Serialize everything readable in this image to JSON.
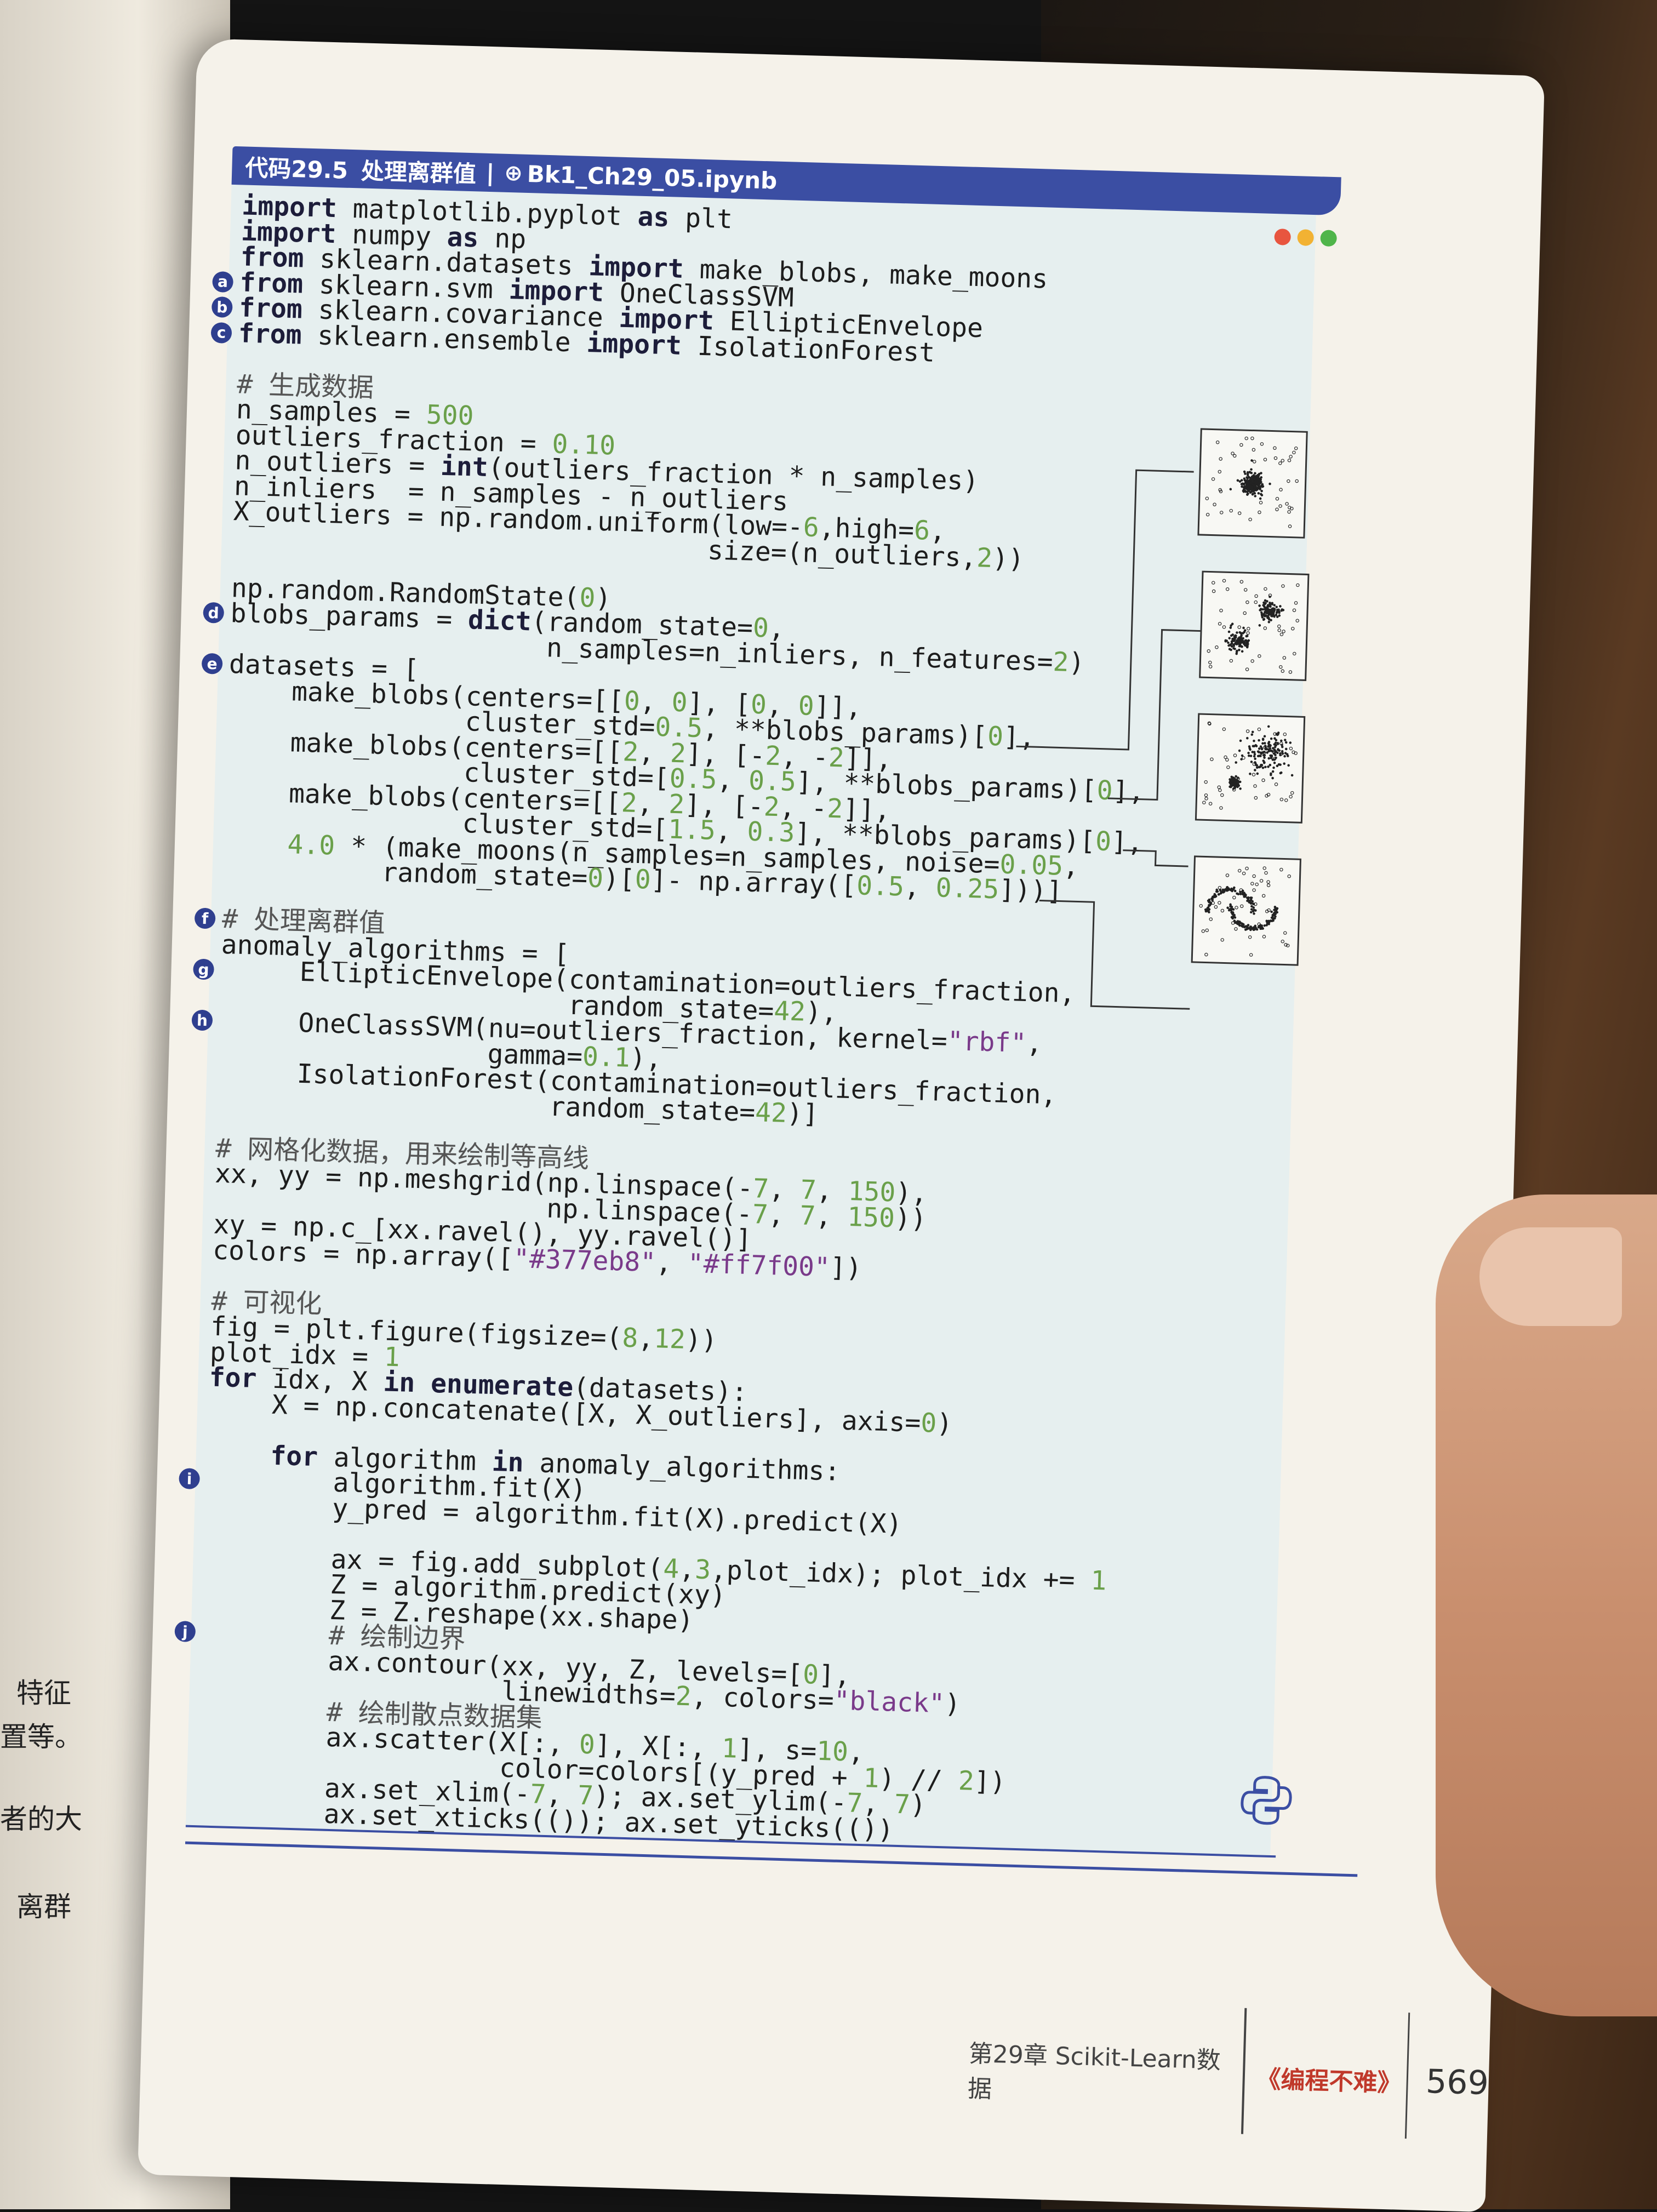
{
  "header": {
    "code_id": "代码29.5",
    "title": "处理离群值",
    "separator": "|",
    "file_icon": "notebook-icon",
    "filename": "Bk1_Ch29_05.ipynb"
  },
  "window_dots": [
    "#e8553f",
    "#f2b233",
    "#4fb54a"
  ],
  "markers": [
    {
      "letter": "a",
      "line": 3
    },
    {
      "letter": "b",
      "line": 4
    },
    {
      "letter": "c",
      "line": 5
    },
    {
      "letter": "d",
      "line": 16
    },
    {
      "letter": "e",
      "line": 18
    },
    {
      "letter": "f",
      "line": 28
    },
    {
      "letter": "g",
      "line": 30
    },
    {
      "letter": "h",
      "line": 32
    },
    {
      "letter": "i",
      "line": 50
    },
    {
      "letter": "j",
      "line": 56
    }
  ],
  "code_lines": [
    "import matplotlib.pyplot as plt",
    "import numpy as np",
    "from sklearn.datasets import make_blobs, make_moons",
    "from sklearn.svm import OneClassSVM",
    "from sklearn.covariance import EllipticEnvelope",
    "from sklearn.ensemble import IsolationForest",
    "",
    "# 生成数据",
    "n_samples = 500",
    "outliers_fraction = 0.10",
    "n_outliers = int(outliers_fraction * n_samples)",
    "n_inliers  = n_samples - n_outliers",
    "X_outliers = np.random.uniform(low=-6,high=6,",
    "                              size=(n_outliers,2))",
    "",
    "np.random.RandomState(0)",
    "blobs_params = dict(random_state=0,",
    "                    n_samples=n_inliers, n_features=2)",
    "datasets = [",
    "    make_blobs(centers=[[0, 0], [0, 0]],",
    "               cluster_std=0.5, **blobs_params)[0],",
    "    make_blobs(centers=[[2, 2], [-2, -2]],",
    "               cluster_std=[0.5, 0.5], **blobs_params)[0],",
    "    make_blobs(centers=[[2, 2], [-2, -2]],",
    "               cluster_std=[1.5, 0.3], **blobs_params)[0],",
    "    4.0 * (make_moons(n_samples=n_samples, noise=0.05,",
    "          random_state=0)[0]- np.array([0.5, 0.25]))]",
    "",
    "# 处理离群值",
    "anomaly_algorithms = [",
    "     EllipticEnvelope(contamination=outliers_fraction,",
    "                      random_state=42),",
    "     OneClassSVM(nu=outliers_fraction, kernel=\"rbf\",",
    "                 gamma=0.1),",
    "     IsolationForest(contamination=outliers_fraction,",
    "                     random_state=42)]",
    "",
    "# 网格化数据，用来绘制等高线",
    "xx, yy = np.meshgrid(np.linspace(-7, 7, 150),",
    "                     np.linspace(-7, 7, 150))",
    "xy = np.c_[xx.ravel(), yy.ravel()]",
    "colors = np.array([\"#377eb8\", \"#ff7f00\"])",
    "",
    "# 可视化",
    "fig = plt.figure(figsize=(8,12))",
    "plot_idx = 1",
    "for idx, X in enumerate(datasets):",
    "    X = np.concatenate([X, X_outliers], axis=0)",
    "",
    "    for algorithm in anomaly_algorithms:",
    "        algorithm.fit(X)",
    "        y_pred = algorithm.fit(X).predict(X)",
    "",
    "        ax = fig.add_subplot(4,3,plot_idx); plot_idx += 1",
    "        Z = algorithm.predict(xy)",
    "        Z = Z.reshape(xx.shape)",
    "        # 绘制边界",
    "        ax.contour(xx, yy, Z, levels=[0],",
    "                   linewidths=2, colors=\"black\")",
    "        # 绘制散点数据集",
    "        ax.scatter(X[:, 0], X[:, 1], s=10,",
    "                   color=colors[(y_pred + 1) // 2])",
    "        ax.set_xlim(-7, 7); ax.set_ylim(-7, 7)",
    "        ax.set_xticks(()); ax.set_yticks(())"
  ],
  "thumbnails": [
    {
      "name": "single-blob-dataset",
      "line": 20
    },
    {
      "name": "two-blobs-dataset",
      "line": 22
    },
    {
      "name": "unequal-blobs-dataset",
      "line": 24
    },
    {
      "name": "moons-dataset",
      "line": 26
    }
  ],
  "python_icon": "python-logo-icon",
  "footer": {
    "chapter": "第29章  Scikit-Learn数据",
    "book_title": "《编程不难》",
    "page_number": "569"
  },
  "left_page_fragments": [
    "特征",
    "置等。",
    "者的大",
    "离群"
  ]
}
